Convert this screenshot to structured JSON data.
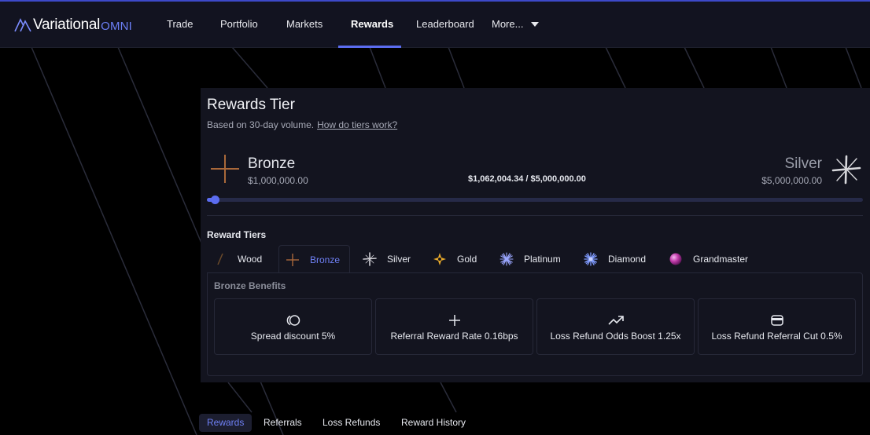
{
  "brand": {
    "name": "Variational",
    "sub": "OMNI",
    "accent": "#5b6cf0"
  },
  "nav": {
    "items": [
      "Trade",
      "Portfolio",
      "Markets",
      "Rewards",
      "Leaderboard",
      "More..."
    ],
    "active": "Rewards"
  },
  "card": {
    "title": "Rewards Tier",
    "subtitle": "Based on 30-day volume.",
    "help_link": "How do tiers work?",
    "current_tier": {
      "name": "Bronze",
      "threshold": "$1,000,000.00",
      "icon": "bronze-cross-icon"
    },
    "next_tier": {
      "name": "Silver",
      "threshold": "$5,000,000.00",
      "icon": "silver-star-icon"
    },
    "progress_text": "$1,062,004.34 / $5,000,000.00",
    "progress_fraction": 0.0124
  },
  "tiers": {
    "label": "Reward Tiers",
    "selected": "Bronze",
    "items": [
      {
        "name": "Wood",
        "icon": "wood-slash-icon"
      },
      {
        "name": "Bronze",
        "icon": "bronze-cross-icon"
      },
      {
        "name": "Silver",
        "icon": "silver-star-icon"
      },
      {
        "name": "Gold",
        "icon": "gold-star-icon"
      },
      {
        "name": "Platinum",
        "icon": "platinum-burst-icon"
      },
      {
        "name": "Diamond",
        "icon": "diamond-burst-icon"
      },
      {
        "name": "Grandmaster",
        "icon": "grandmaster-orb-icon"
      }
    ]
  },
  "benefits": {
    "title": "Bronze Benefits",
    "items": [
      {
        "text": "Spread discount 5%",
        "icon": "coins-icon"
      },
      {
        "text": "Referral Reward Rate 0.16bps",
        "icon": "plus-icon"
      },
      {
        "text": "Loss Refund Odds Boost 1.25x",
        "icon": "trending-up-icon"
      },
      {
        "text": "Loss Refund Referral Cut 0.5%",
        "icon": "wallet-icon"
      }
    ]
  },
  "bottom_tabs": {
    "items": [
      "Rewards",
      "Referrals",
      "Loss Refunds",
      "Reward History"
    ],
    "active": "Rewards"
  }
}
